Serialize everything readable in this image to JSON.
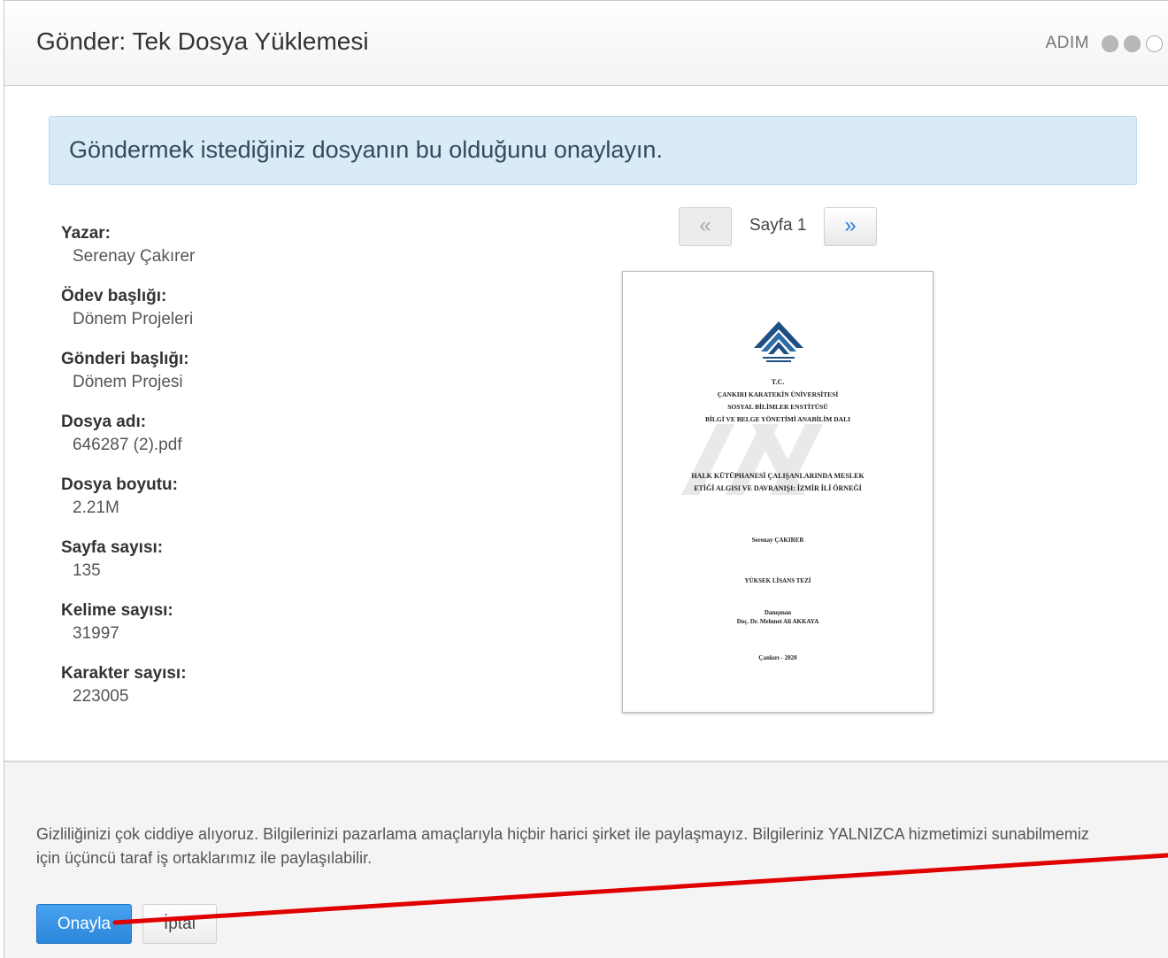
{
  "header": {
    "title": "Gönder: Tek Dosya Yüklemesi",
    "steps_label": "ADIM",
    "steps_total": 3,
    "steps_completed": 2
  },
  "alert": {
    "text": "Göndermek istediğiniz dosyanın bu olduğunu onaylayın."
  },
  "metadata": [
    {
      "label": "Yazar:",
      "value": "Serenay Çakırer"
    },
    {
      "label": "Ödev başlığı:",
      "value": "Dönem Projeleri"
    },
    {
      "label": "Gönderi başlığı:",
      "value": "Dönem Projesi"
    },
    {
      "label": "Dosya adı:",
      "value": "646287 (2).pdf"
    },
    {
      "label": "Dosya boyutu:",
      "value": "2.21M"
    },
    {
      "label": "Sayfa sayısı:",
      "value": "135"
    },
    {
      "label": "Kelime sayısı:",
      "value": "31997"
    },
    {
      "label": "Karakter sayısı:",
      "value": "223005"
    }
  ],
  "pager": {
    "prev_symbol": "«",
    "next_symbol": "»",
    "page_label": "Sayfa 1"
  },
  "preview": {
    "lines": [
      "T.C.",
      "ÇANKIRI KARATEKİN ÜNİVERSİTESİ",
      "SOSYAL BİLİMLER ENSTİTÜSÜ",
      "BİLGİ VE BELGE YÖNETİMİ ANABİLİM DALI",
      "HALK KÜTÜPHANESİ ÇALIŞANLARINDA MESLEK",
      "ETİĞİ ALGISI VE DAVRANIŞI: İZMİR İLİ ÖRNEĞİ",
      "Serenay ÇAKIRER",
      "YÜKSEK LİSANS TEZİ",
      "Danışman",
      "Doç. Dr. Mehmet Ali AKKAYA",
      "Çankırı - 2020"
    ]
  },
  "footer": {
    "privacy_text": "Gizliliğinizi çok ciddiye alıyoruz. Bilgilerinizi pazarlama amaçlarıyla hiçbir harici şirket ile paylaşmayız. Bilgileriniz YALNIZCA hizmetimizi sunabilmemiz için üçüncü taraf iş ortaklarımız ile paylaşılabilir.",
    "confirm_label": "Onayla",
    "cancel_label": "İptal"
  },
  "colors": {
    "accent": "#2b86dc",
    "alert_bg": "#d9ebf7",
    "annotation": "#e00000"
  }
}
